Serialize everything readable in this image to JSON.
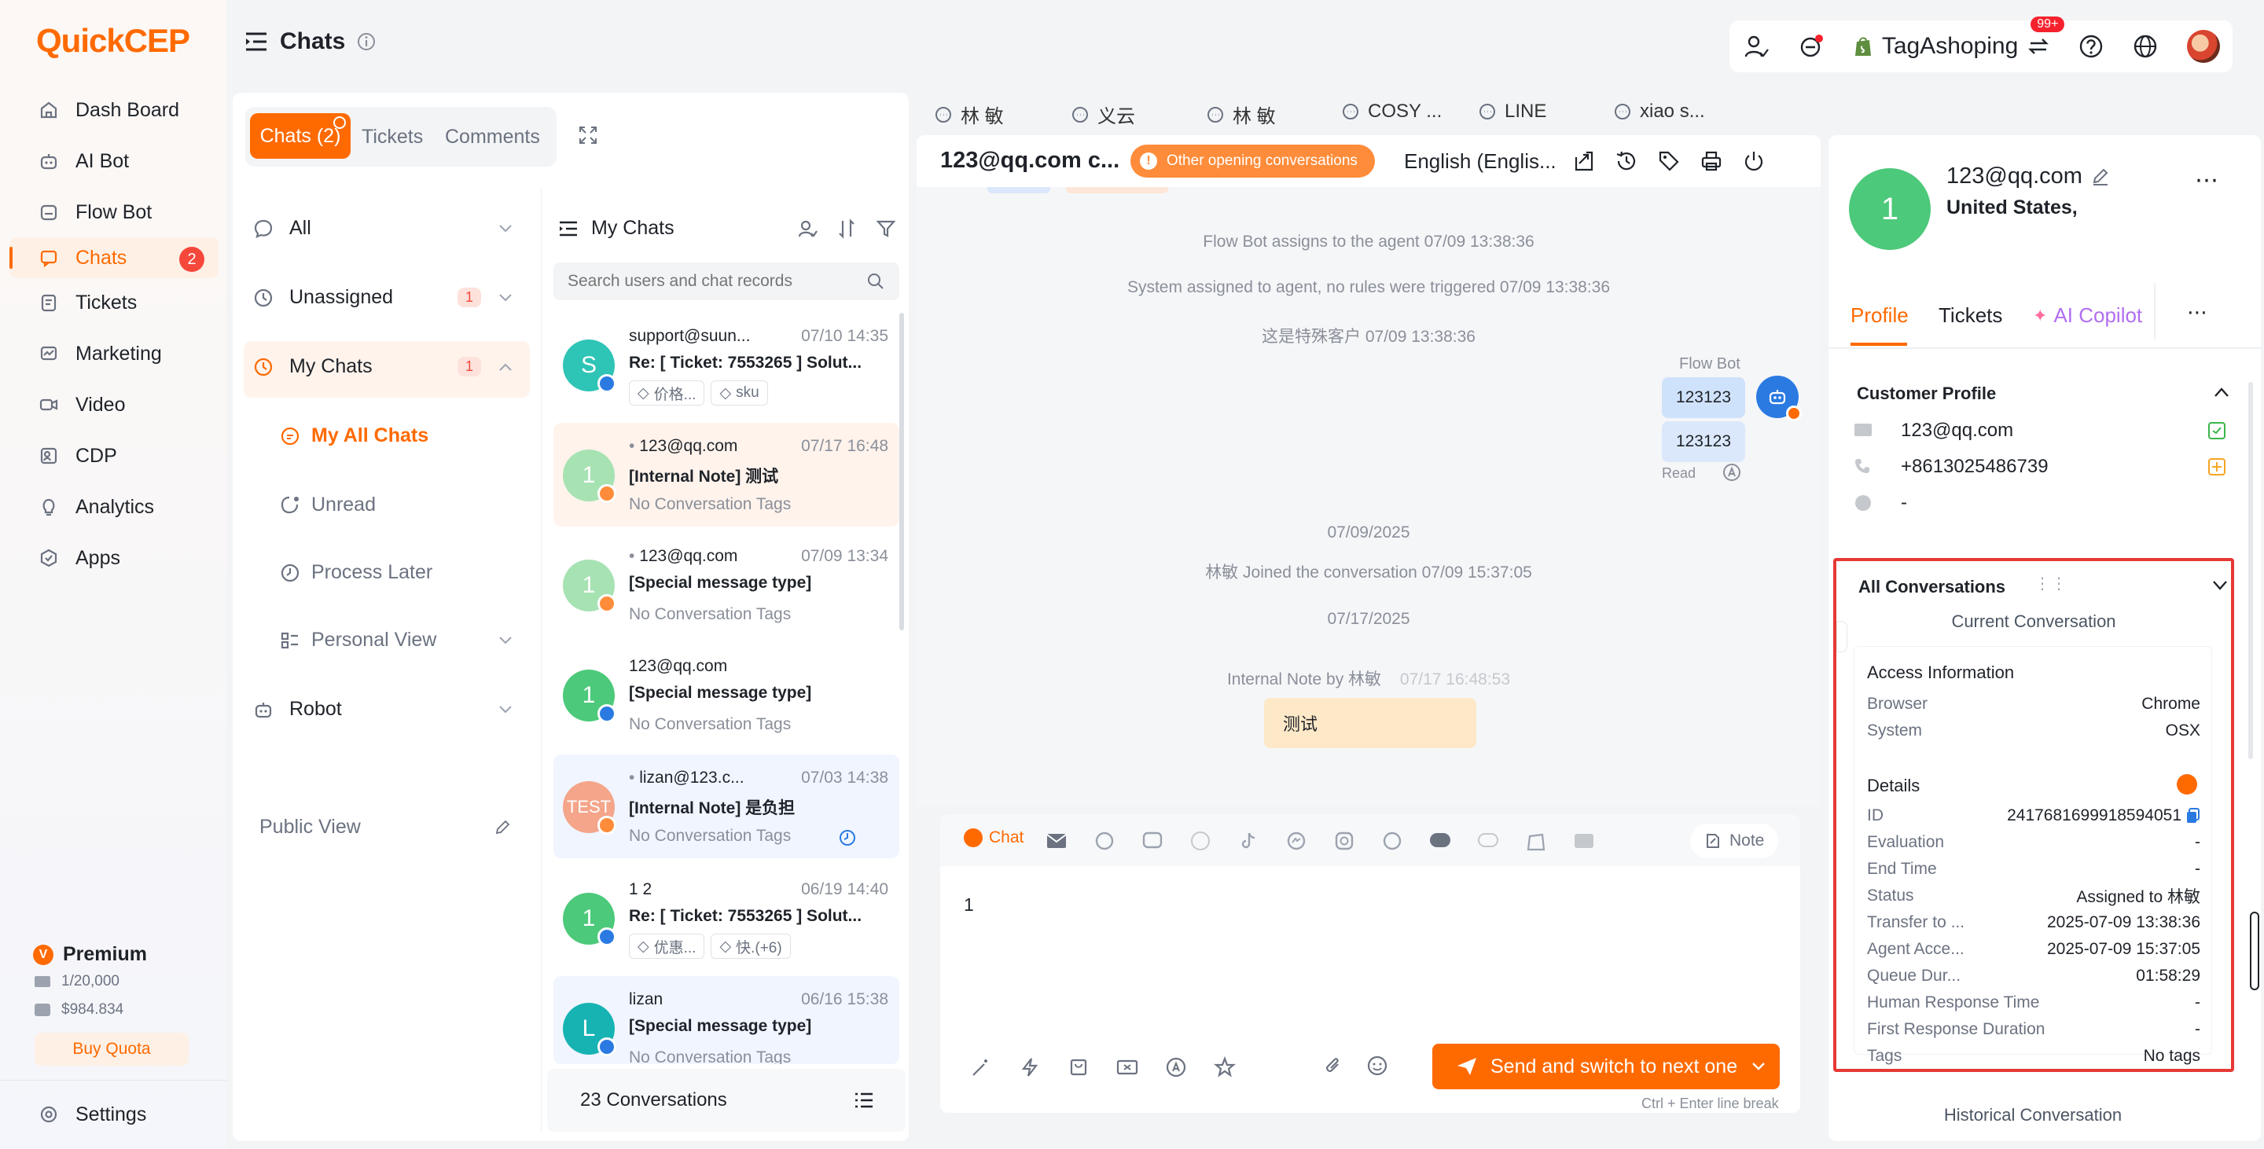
{
  "app": {
    "logo_q": "Q",
    "logo_rest": "uickCEP",
    "page_title": "Chats"
  },
  "nav": {
    "items": [
      {
        "label": "Dash Board",
        "icon": "home-icon"
      },
      {
        "label": "AI Bot",
        "icon": "robot-icon"
      },
      {
        "label": "Flow Bot",
        "icon": "flow-bot-icon"
      },
      {
        "label": "Chats",
        "icon": "chat-icon",
        "badge": "2"
      },
      {
        "label": "Tickets",
        "icon": "ticket-icon"
      },
      {
        "label": "Marketing",
        "icon": "marketing-icon"
      },
      {
        "label": "Video",
        "icon": "video-icon"
      },
      {
        "label": "CDP",
        "icon": "cdp-icon"
      },
      {
        "label": "Analytics",
        "icon": "bulb-icon"
      },
      {
        "label": "Apps",
        "icon": "apps-icon"
      }
    ],
    "plan": "Premium",
    "quota_count": "1/20,000",
    "balance": "$984.834",
    "buy_quota": "Buy Quota",
    "settings": "Settings"
  },
  "topbar": {
    "store": "TagAshoping",
    "notif_badge": "99+"
  },
  "chat_tabs": {
    "chats": "Chats (2)",
    "tickets": "Tickets",
    "comments": "Comments"
  },
  "filters": {
    "all": "All",
    "unassigned": "Unassigned",
    "unassigned_count": "1",
    "my_chats": "My Chats",
    "my_chats_count": "1",
    "my_all_chats": "My All Chats",
    "unread": "Unread",
    "process_later": "Process Later",
    "personal_view": "Personal View",
    "robot": "Robot",
    "public_view": "Public View"
  },
  "list": {
    "title": "My Chats",
    "search_placeholder": "Search users and chat records",
    "footer": "23 Conversations",
    "items": [
      {
        "name": "support@suun...",
        "time": "07/10 14:35",
        "subject": "Re: [ Ticket: 7553265 ] Solut...",
        "tag1": "价格...",
        "tag2": "sku",
        "avatar": "S"
      },
      {
        "name": "123@qq.com",
        "time": "07/17 16:48",
        "subject": "[Internal Note] 测试",
        "tags": "No Conversation Tags",
        "avatar": "1"
      },
      {
        "name": "123@qq.com",
        "time": "07/09 13:34",
        "subject": "[Special message type]",
        "tags": "No Conversation Tags",
        "avatar": "1"
      },
      {
        "name": "123@qq.com",
        "time": "",
        "subject": "[Special message type]",
        "tags": "No Conversation Tags",
        "avatar": "1"
      },
      {
        "name": "lizan@123.c...",
        "time": "07/03 14:38",
        "subject": "[Internal Note] 是负担",
        "tags": "No Conversation Tags",
        "avatar": "TEST"
      },
      {
        "name": "1 2",
        "time": "06/19 14:40",
        "subject": "Re: [ Ticket: 7553265 ] Solut...",
        "tag1": "优惠...",
        "tag2": "快.(+6)",
        "avatar": "1"
      },
      {
        "name": "lizan",
        "time": "06/16 15:38",
        "subject": "[Special message type]",
        "tags": "No Conversation Tags",
        "avatar": "L"
      }
    ]
  },
  "conv_tabs": [
    "林 敏",
    "义云",
    "林 敏",
    "COSY ...",
    "LINE",
    "xiao s..."
  ],
  "conversation": {
    "title": "123@qq.com c...",
    "other_opening": "Other opening conversations",
    "language": "English (Englis...",
    "msgs": {
      "sys1": "Flow Bot assigns to the agent  07/09 13:38:36",
      "sys2": "System assigned to agent, no rules were triggered  07/09 13:38:36",
      "sys3": "这是特殊客户  07/09 13:38:36",
      "bot_name": "Flow Bot",
      "bubble1": "123123",
      "bubble2": "123123",
      "read": "Read",
      "date1": "07/09/2025",
      "joined": "林敏 Joined the conversation  07/09 15:37:05",
      "date2": "07/17/2025",
      "note_by": "Internal Note by 林敏",
      "note_time": "07/17 16:48:53",
      "note_text": "测试"
    },
    "composer": {
      "chat_label": "Chat",
      "note_label": "Note",
      "text": "1",
      "send": "Send and switch to next one",
      "hint": "Ctrl + Enter line break"
    }
  },
  "customer": {
    "avatar": "1",
    "email": "123@qq.com",
    "country": "United States,",
    "tabs": {
      "profile": "Profile",
      "tickets": "Tickets",
      "copilot": "AI Copilot"
    },
    "profile_title": "Customer Profile",
    "profile_email": "123@qq.com",
    "phone": "+8613025486739",
    "whatsapp": "-",
    "all_conversations": "All Conversations",
    "current_conversation": "Current Conversation",
    "access_info": "Access Information",
    "browser_k": "Browser",
    "browser_v": "Chrome",
    "system_k": "System",
    "system_v": "OSX",
    "details": "Details",
    "details_rows": [
      {
        "k": "ID",
        "v": "2417681699918594051"
      },
      {
        "k": "Evaluation",
        "v": "-"
      },
      {
        "k": "End Time",
        "v": "-"
      },
      {
        "k": "Status",
        "v": "Assigned to 林敏"
      },
      {
        "k": "Transfer to ...",
        "v": "2025-07-09 13:38:36"
      },
      {
        "k": "Agent Acce...",
        "v": "2025-07-09 15:37:05"
      },
      {
        "k": "Queue Dur...",
        "v": "01:58:29"
      },
      {
        "k": "Human Response Time",
        "v": "-"
      },
      {
        "k": "First Response Duration",
        "v": "-"
      },
      {
        "k": "Tags",
        "v": "No tags"
      }
    ],
    "historical": "Historical Conversation"
  },
  "colors": {
    "accent": "#ff6a00",
    "highlight_border": "#e53935"
  }
}
